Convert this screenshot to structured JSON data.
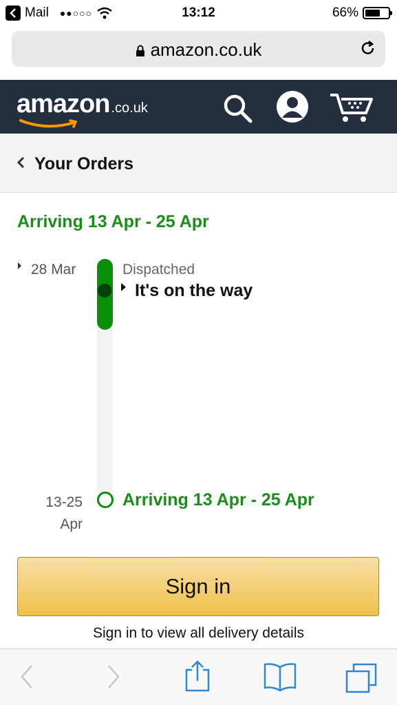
{
  "status_bar": {
    "back_app": "Mail",
    "signal": "●●○○○",
    "time": "13:12",
    "battery": "66%",
    "battery_level": 0.66
  },
  "browser": {
    "url": "amazon.co.uk"
  },
  "header": {
    "logo_word": "amazon",
    "logo_tld": ".co.uk",
    "brand_color": "#232f3e",
    "icons": [
      "search-icon",
      "account-icon",
      "cart-icon"
    ]
  },
  "breadcrumb": {
    "label": "Your Orders"
  },
  "order": {
    "title": "Arriving 13 Apr - 25 Apr",
    "progress": 0.3,
    "events": [
      {
        "date": "28 Mar",
        "status": "Dispatched",
        "detail": "It's on the way"
      }
    ],
    "arrival": {
      "date_line1": "13-25",
      "date_line2": "Apr",
      "label": "Arriving 13 Apr - 25 Apr"
    },
    "accent_color": "#1a8e1a"
  },
  "signin": {
    "button_label": "Sign in",
    "note": "Sign in to view all delivery details"
  },
  "toolbar": {
    "icons": [
      "back-icon",
      "forward-icon",
      "share-icon",
      "bookmarks-icon",
      "tabs-icon"
    ]
  }
}
